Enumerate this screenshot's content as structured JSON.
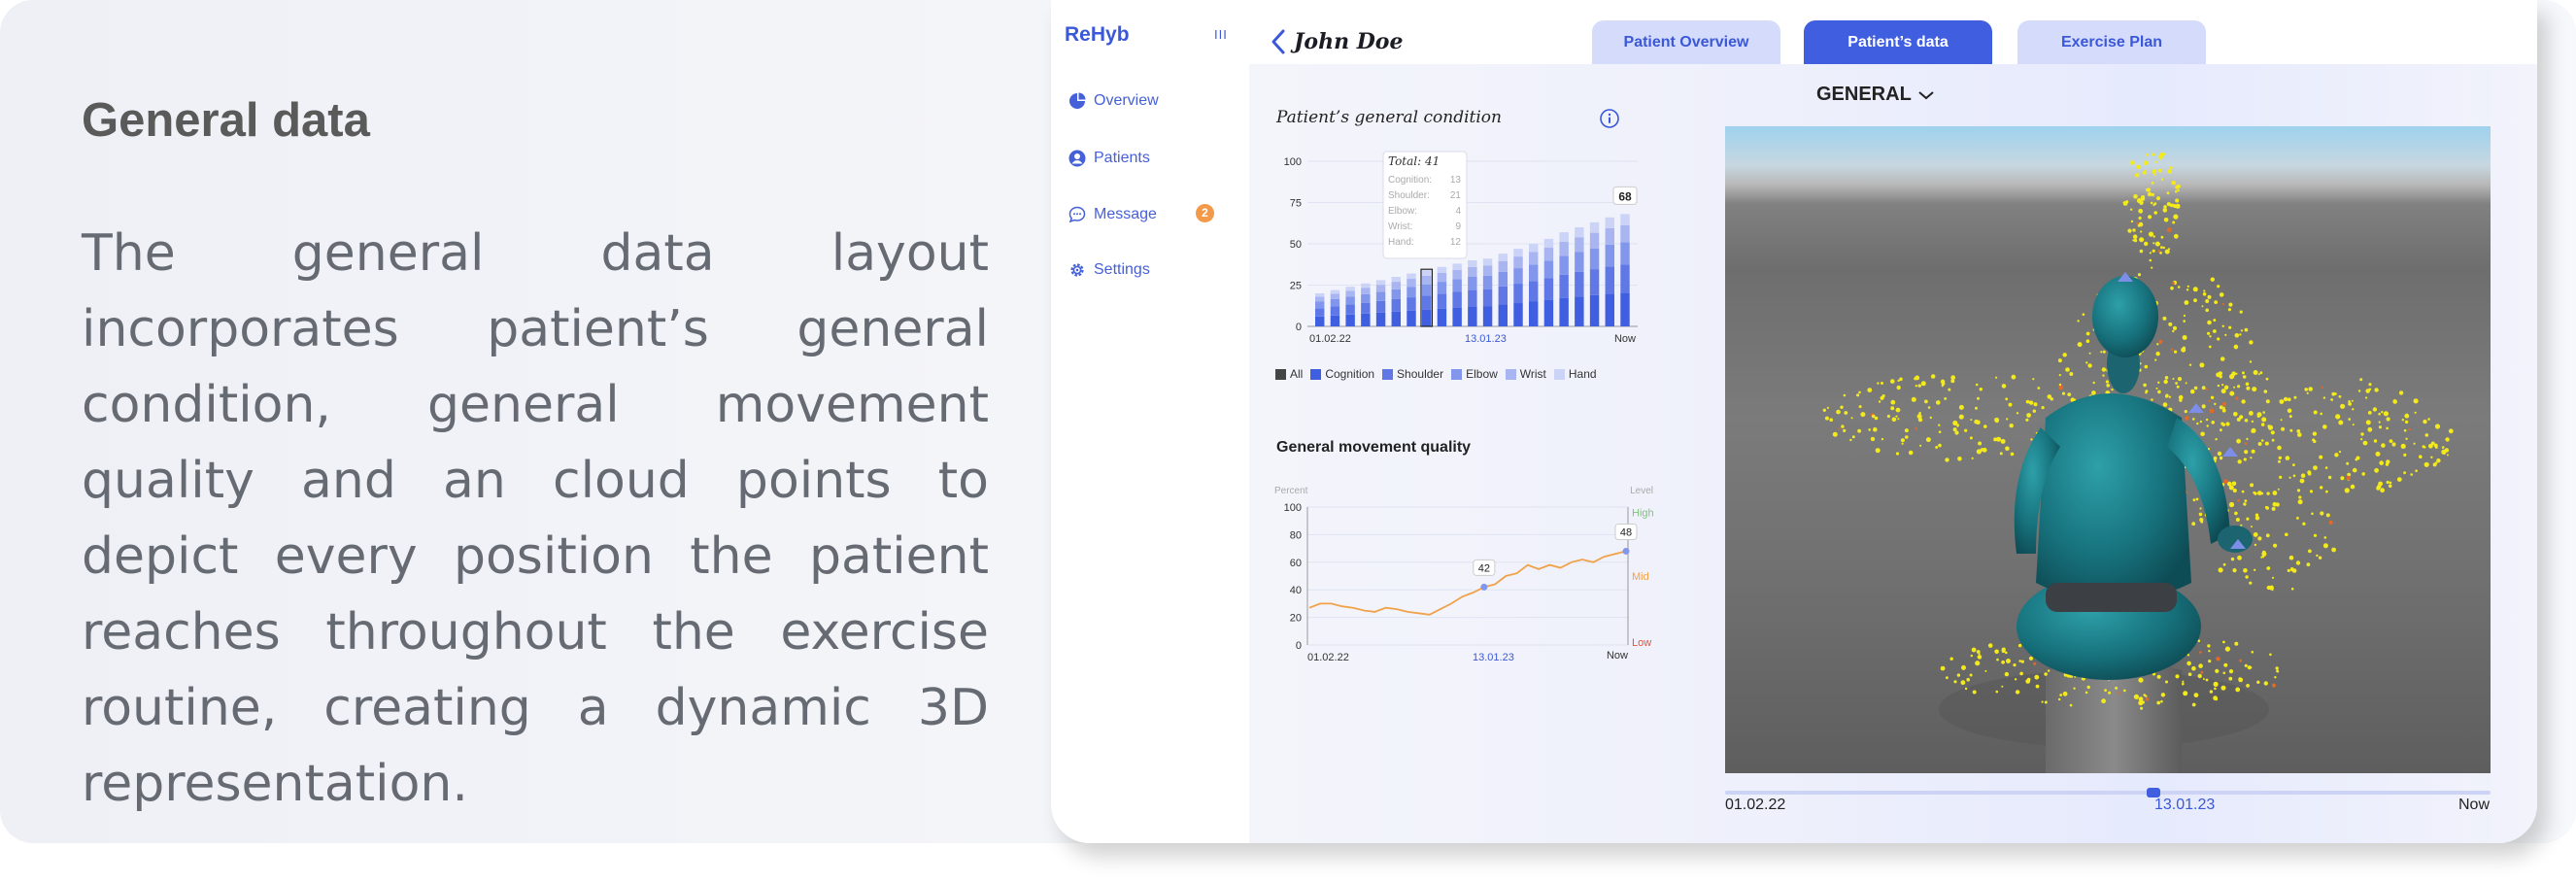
{
  "description": {
    "title": "General data",
    "body": "The general data layout incorporates patient’s general condition, general movement quality and an cloud points to depict every position the patient reaches throughout the exercise routine, creating a dynamic 3D representation."
  },
  "app": {
    "logo": "ReHyb",
    "collapse_glyph": "III",
    "nav": [
      {
        "label": "Overview",
        "icon": "pie-chart-icon"
      },
      {
        "label": "Patients",
        "icon": "user-icon"
      },
      {
        "label": "Message",
        "icon": "chat-icon"
      },
      {
        "label": "Settings",
        "icon": "gear-icon"
      }
    ],
    "message_badge": "2",
    "patient_name": "John Doe",
    "tabs": [
      {
        "label": "Patient Overview",
        "active": false
      },
      {
        "label": "Patient’s data",
        "active": true
      },
      {
        "label": "Exercise Plan",
        "active": false
      }
    ],
    "view_selector": "GENERAL",
    "colors": {
      "accent": "#3f5ee0",
      "tab_inactive": "#d5dbfa",
      "badge": "#f39a4a"
    }
  },
  "condition": {
    "title": "Patient’s general condition",
    "legend": [
      "All",
      "Cognition",
      "Shoulder",
      "Elbow",
      "Wrist",
      "Hand"
    ],
    "tooltip": {
      "total": "Total: 41",
      "rows": [
        {
          "label": "Cognition:",
          "value": "13"
        },
        {
          "label": "Shoulder:",
          "value": "21"
        },
        {
          "label": "Elbow:",
          "value": "4"
        },
        {
          "label": "Wrist:",
          "value": "9"
        },
        {
          "label": "Hand:",
          "value": "12"
        }
      ]
    }
  },
  "movement": {
    "title": "General movement quality",
    "y_caption": "Percent",
    "level_caption": "Level",
    "levels": [
      "High",
      "Mid",
      "Low"
    ],
    "level_colors": [
      "#7fc47a",
      "#f0a24a",
      "#e0533c"
    ]
  },
  "timeline": {
    "start": "01.02.22",
    "mid": "13.01.23",
    "end": "Now",
    "position": 0.56
  },
  "chart_data": [
    {
      "type": "bar",
      "title": "Patient’s general condition",
      "yticks": [
        0,
        25,
        50,
        75,
        100
      ],
      "ylim": [
        0,
        100
      ],
      "xticks": [
        "01.02.22",
        "13.01.23",
        "Now"
      ],
      "values": [
        20,
        22,
        24,
        26,
        28,
        30,
        32,
        34,
        36,
        38,
        40,
        41,
        44,
        47,
        50,
        53,
        57,
        60,
        63,
        66,
        68
      ],
      "highlight_index": 7,
      "end_label": "68",
      "legend": [
        "All",
        "Cognition",
        "Shoulder",
        "Elbow",
        "Wrist",
        "Hand"
      ],
      "grid": true
    },
    {
      "type": "line",
      "title": "General movement quality",
      "ylabel": "Percent",
      "yticks": [
        0,
        20,
        40,
        60,
        80,
        100
      ],
      "ylim": [
        0,
        100
      ],
      "xticks": [
        "01.02.22",
        "13.01.23",
        "Now"
      ],
      "values": [
        27,
        30,
        30,
        28,
        27,
        25,
        24,
        27,
        26,
        24,
        23,
        22,
        26,
        30,
        35,
        38,
        42,
        44,
        50,
        52,
        58,
        55,
        58,
        56,
        60,
        62,
        60,
        64,
        66,
        68
      ],
      "annotations": [
        {
          "index": 16,
          "label": "42"
        },
        {
          "index": 29,
          "label": "48"
        }
      ],
      "grid": true
    }
  ]
}
